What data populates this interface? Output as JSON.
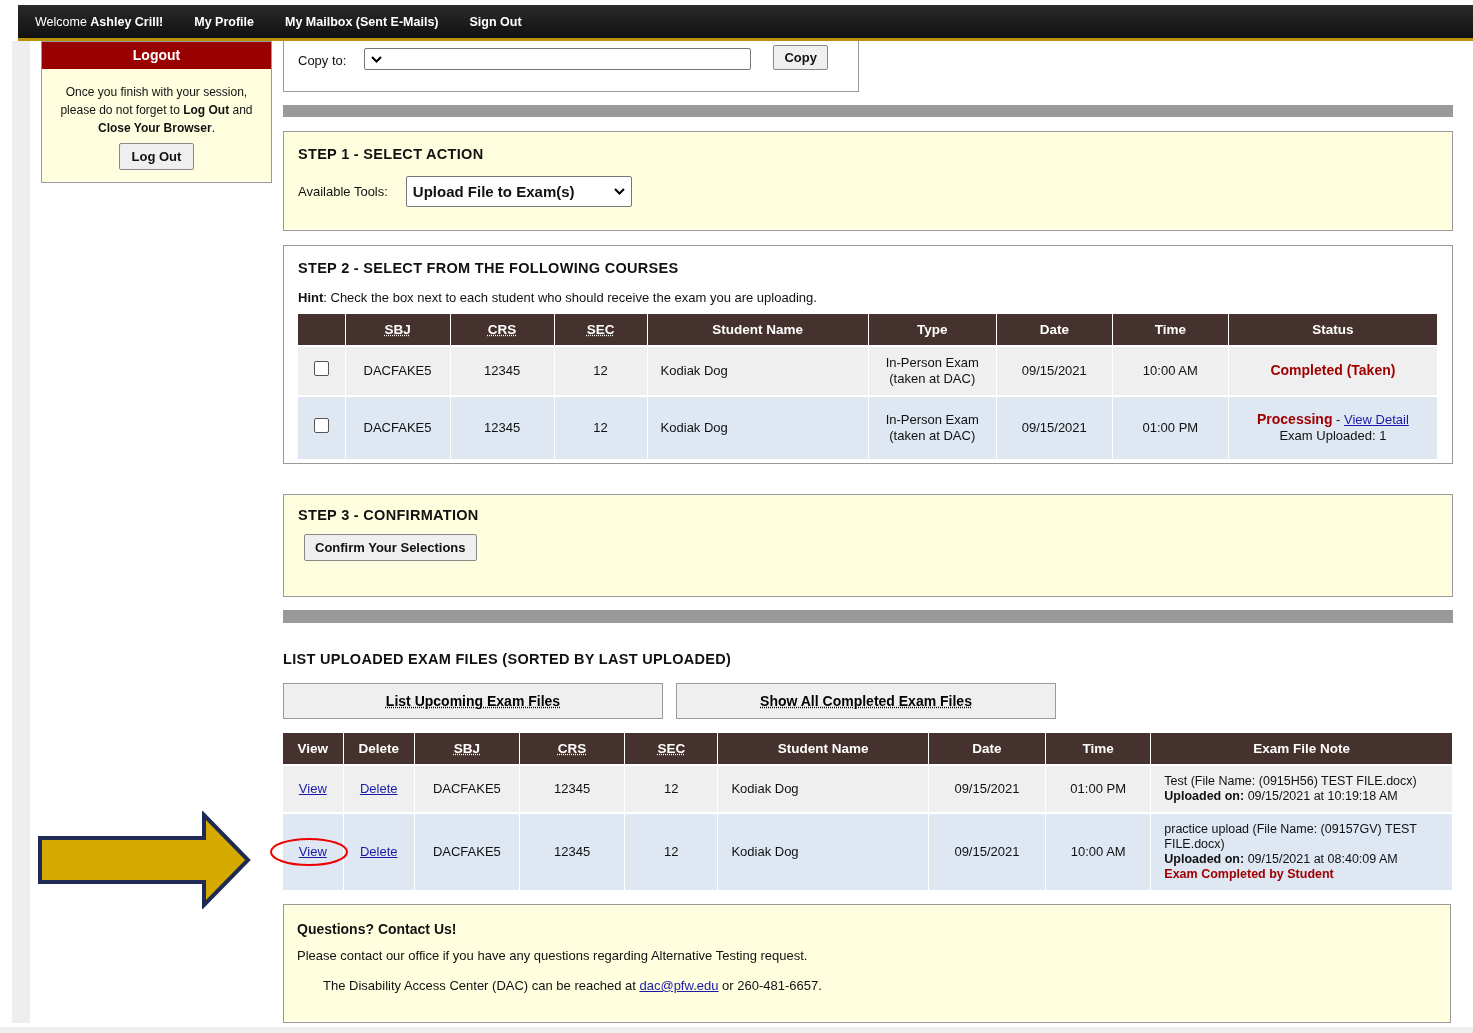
{
  "topbar": {
    "welcome": "Welcome **Ashley Crill!**",
    "links": [
      "My Profile",
      "My Mailbox (Sent E-Mails)",
      "Sign Out"
    ]
  },
  "sidebar": {
    "title": "Logout",
    "message": "Once you finish with your session, please do not forget to **Log Out** and **Close Your Browser**.",
    "button": "Log Out"
  },
  "copy": {
    "label": "Copy to:",
    "button": "Copy"
  },
  "step1": {
    "title": "STEP 1 - SELECT ACTION",
    "label": "Available Tools:",
    "value": "Upload File to Exam(s)"
  },
  "step2": {
    "title": "STEP 2 - SELECT FROM THE FOLLOWING COURSES",
    "hint": "**Hint**: Check the box next to each student who should receive the exam you are uploading.",
    "columns": [
      {
        "label": "SBJ",
        "sortable": true
      },
      {
        "label": "CRS",
        "sortable": true
      },
      {
        "label": "SEC",
        "sortable": true
      },
      {
        "label": "Student Name",
        "sortable": false
      },
      {
        "label": "Type",
        "sortable": false
      },
      {
        "label": "Date",
        "sortable": false
      },
      {
        "label": "Time",
        "sortable": false
      },
      {
        "label": "Status",
        "sortable": false
      }
    ],
    "rows": [
      {
        "checked": false,
        "sbj": "DACFAKE5",
        "crs": "12345",
        "sec": "12",
        "student": "Kodiak Dog",
        "type": [
          "In-Person Exam",
          "(taken at DAC)"
        ],
        "date": "09/15/2021",
        "time": "10:00 AM",
        "status": {
          "label": "Completed (Taken)"
        }
      },
      {
        "checked": false,
        "sbj": "DACFAKE5",
        "crs": "12345",
        "sec": "12",
        "student": "Kodiak Dog",
        "type": [
          "In-Person Exam",
          "(taken at DAC)"
        ],
        "date": "09/15/2021",
        "time": "01:00 PM",
        "status": {
          "label": "Processing",
          "separator": " - ",
          "link": "View Detail",
          "detail": "Exam Uploaded: 1"
        }
      }
    ]
  },
  "step3": {
    "title": "STEP 3 - CONFIRMATION",
    "button": "Confirm Your Selections"
  },
  "uploaded": {
    "title": "LIST UPLOADED EXAM FILES (SORTED BY LAST UPLOADED)",
    "buttons": [
      "List Upcoming Exam Files",
      "Show All Completed Exam Files"
    ],
    "columns": [
      {
        "label": "View",
        "sortable": false
      },
      {
        "label": "Delete",
        "sortable": false
      },
      {
        "label": "SBJ",
        "sortable": true
      },
      {
        "label": "CRS",
        "sortable": true
      },
      {
        "label": "SEC",
        "sortable": true
      },
      {
        "label": "Student Name",
        "sortable": false
      },
      {
        "label": "Date",
        "sortable": false
      },
      {
        "label": "Time",
        "sortable": false
      },
      {
        "label": "Exam File Note",
        "sortable": false
      }
    ],
    "rows": [
      {
        "view": "View",
        "delete": "Delete",
        "circled": false,
        "sbj": "DACFAKE5",
        "crs": "12345",
        "sec": "12",
        "student": "Kodiak Dog",
        "date": "09/15/2021",
        "time": "01:00 PM",
        "note": [
          {
            "kind": "plain",
            "text": "Test (File Name: (0915H56) TEST FILE.docx)"
          },
          {
            "kind": "plain",
            "text": "**Uploaded on:** 09/15/2021 at 10:19:18 AM"
          }
        ]
      },
      {
        "view": "View",
        "delete": "Delete",
        "circled": true,
        "sbj": "DACFAKE5",
        "crs": "12345",
        "sec": "12",
        "student": "Kodiak Dog",
        "date": "09/15/2021",
        "time": "10:00 AM",
        "note": [
          {
            "kind": "plain",
            "text": "practice upload (File Name: (09157GV) TEST FILE.docx)"
          },
          {
            "kind": "plain",
            "text": "**Uploaded on:** 09/15/2021 at 08:40:09 AM"
          },
          {
            "kind": "alert",
            "text": "Exam Completed by Student"
          }
        ]
      }
    ]
  },
  "contact": {
    "title": "Questions? Contact Us!",
    "text": "Please contact our office if you have any questions regarding Alternative Testing request.",
    "line_before": "The Disability Access Center (DAC) can be reached at",
    "email": "dac@pfw.edu",
    "line_after": "or 260-481-6657."
  }
}
